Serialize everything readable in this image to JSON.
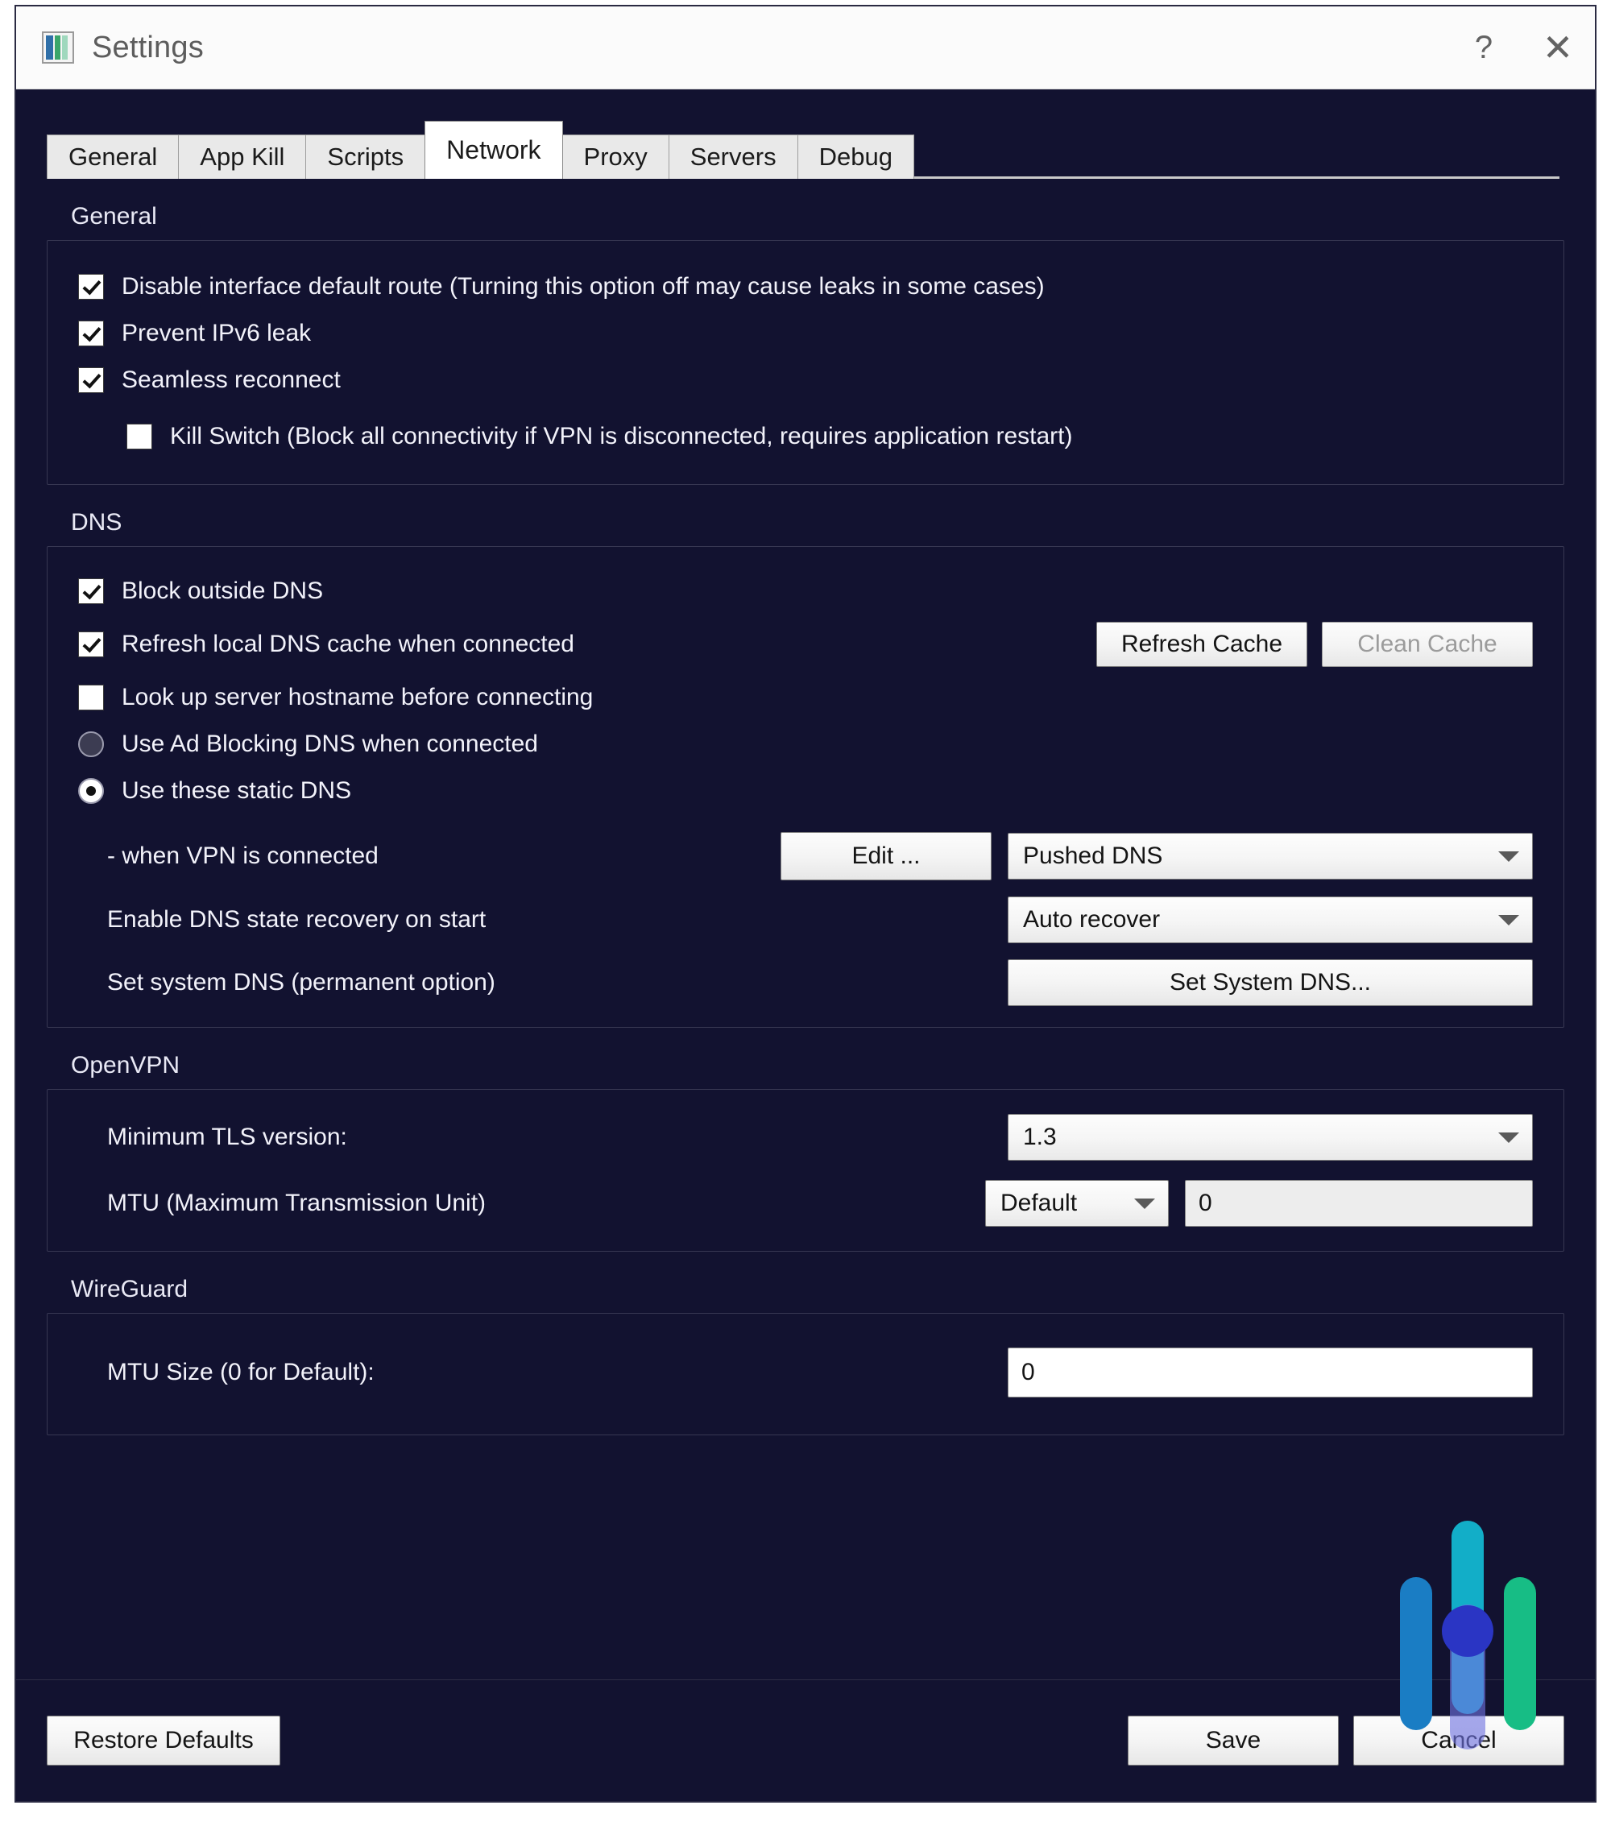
{
  "window": {
    "title": "Settings",
    "icon": "app-window-icon",
    "help_button": "?",
    "close_button": "✕"
  },
  "tabs": [
    {
      "label": "General",
      "active": false
    },
    {
      "label": "App Kill",
      "active": false
    },
    {
      "label": "Scripts",
      "active": false
    },
    {
      "label": "Network",
      "active": true
    },
    {
      "label": "Proxy",
      "active": false
    },
    {
      "label": "Servers",
      "active": false
    },
    {
      "label": "Debug",
      "active": false
    }
  ],
  "sections": {
    "general": {
      "title": "General",
      "checkboxes": [
        {
          "label": "Disable interface default route (Turning this option off may cause leaks in some cases)",
          "checked": true,
          "indented": false
        },
        {
          "label": "Prevent IPv6 leak",
          "checked": true,
          "indented": false
        },
        {
          "label": "Seamless reconnect",
          "checked": true,
          "indented": false
        },
        {
          "label": "Kill Switch (Block all connectivity if VPN is disconnected, requires application restart)",
          "checked": false,
          "indented": true
        }
      ]
    },
    "dns": {
      "title": "DNS",
      "block_outside": {
        "label": "Block outside DNS",
        "checked": true
      },
      "refresh_cache_cb": {
        "label": "Refresh local DNS cache when connected",
        "checked": true
      },
      "lookup_hostname": {
        "label": "Look up server hostname before connecting",
        "checked": false
      },
      "refresh_cache_button": "Refresh Cache",
      "clean_cache_button": "Clean Cache",
      "radio_adblock": {
        "label": "Use Ad Blocking DNS when connected",
        "selected": false
      },
      "radio_static": {
        "label": "Use these static DNS",
        "selected": true
      },
      "when_connected_label": "- when VPN is connected",
      "edit_button": "Edit ...",
      "pushed_dns_value": "Pushed DNS",
      "recovery_label": "Enable DNS state recovery on start",
      "recovery_value": "Auto recover",
      "system_dns_label": "Set system DNS (permanent option)",
      "system_dns_button": "Set System DNS..."
    },
    "openvpn": {
      "title": "OpenVPN",
      "tls_label": "Minimum TLS version:",
      "tls_value": "1.3",
      "mtu_label": "MTU (Maximum Transmission Unit)",
      "mtu_mode_value": "Default",
      "mtu_value": "0"
    },
    "wireguard": {
      "title": "WireGuard",
      "mtu_label": "MTU Size (0 for Default):",
      "mtu_value": "0"
    }
  },
  "footer": {
    "restore_defaults": "Restore Defaults",
    "save": "Save",
    "cancel": "Cancel"
  },
  "colors": {
    "window_bg": "#121230",
    "title_bar_bg": "#fbfbfb",
    "text": "#f2f2fa",
    "logo_blue": "#1a7dc4",
    "logo_cyan": "#12aec8",
    "logo_green": "#17bd85",
    "logo_indigo": "#2a35c4"
  }
}
